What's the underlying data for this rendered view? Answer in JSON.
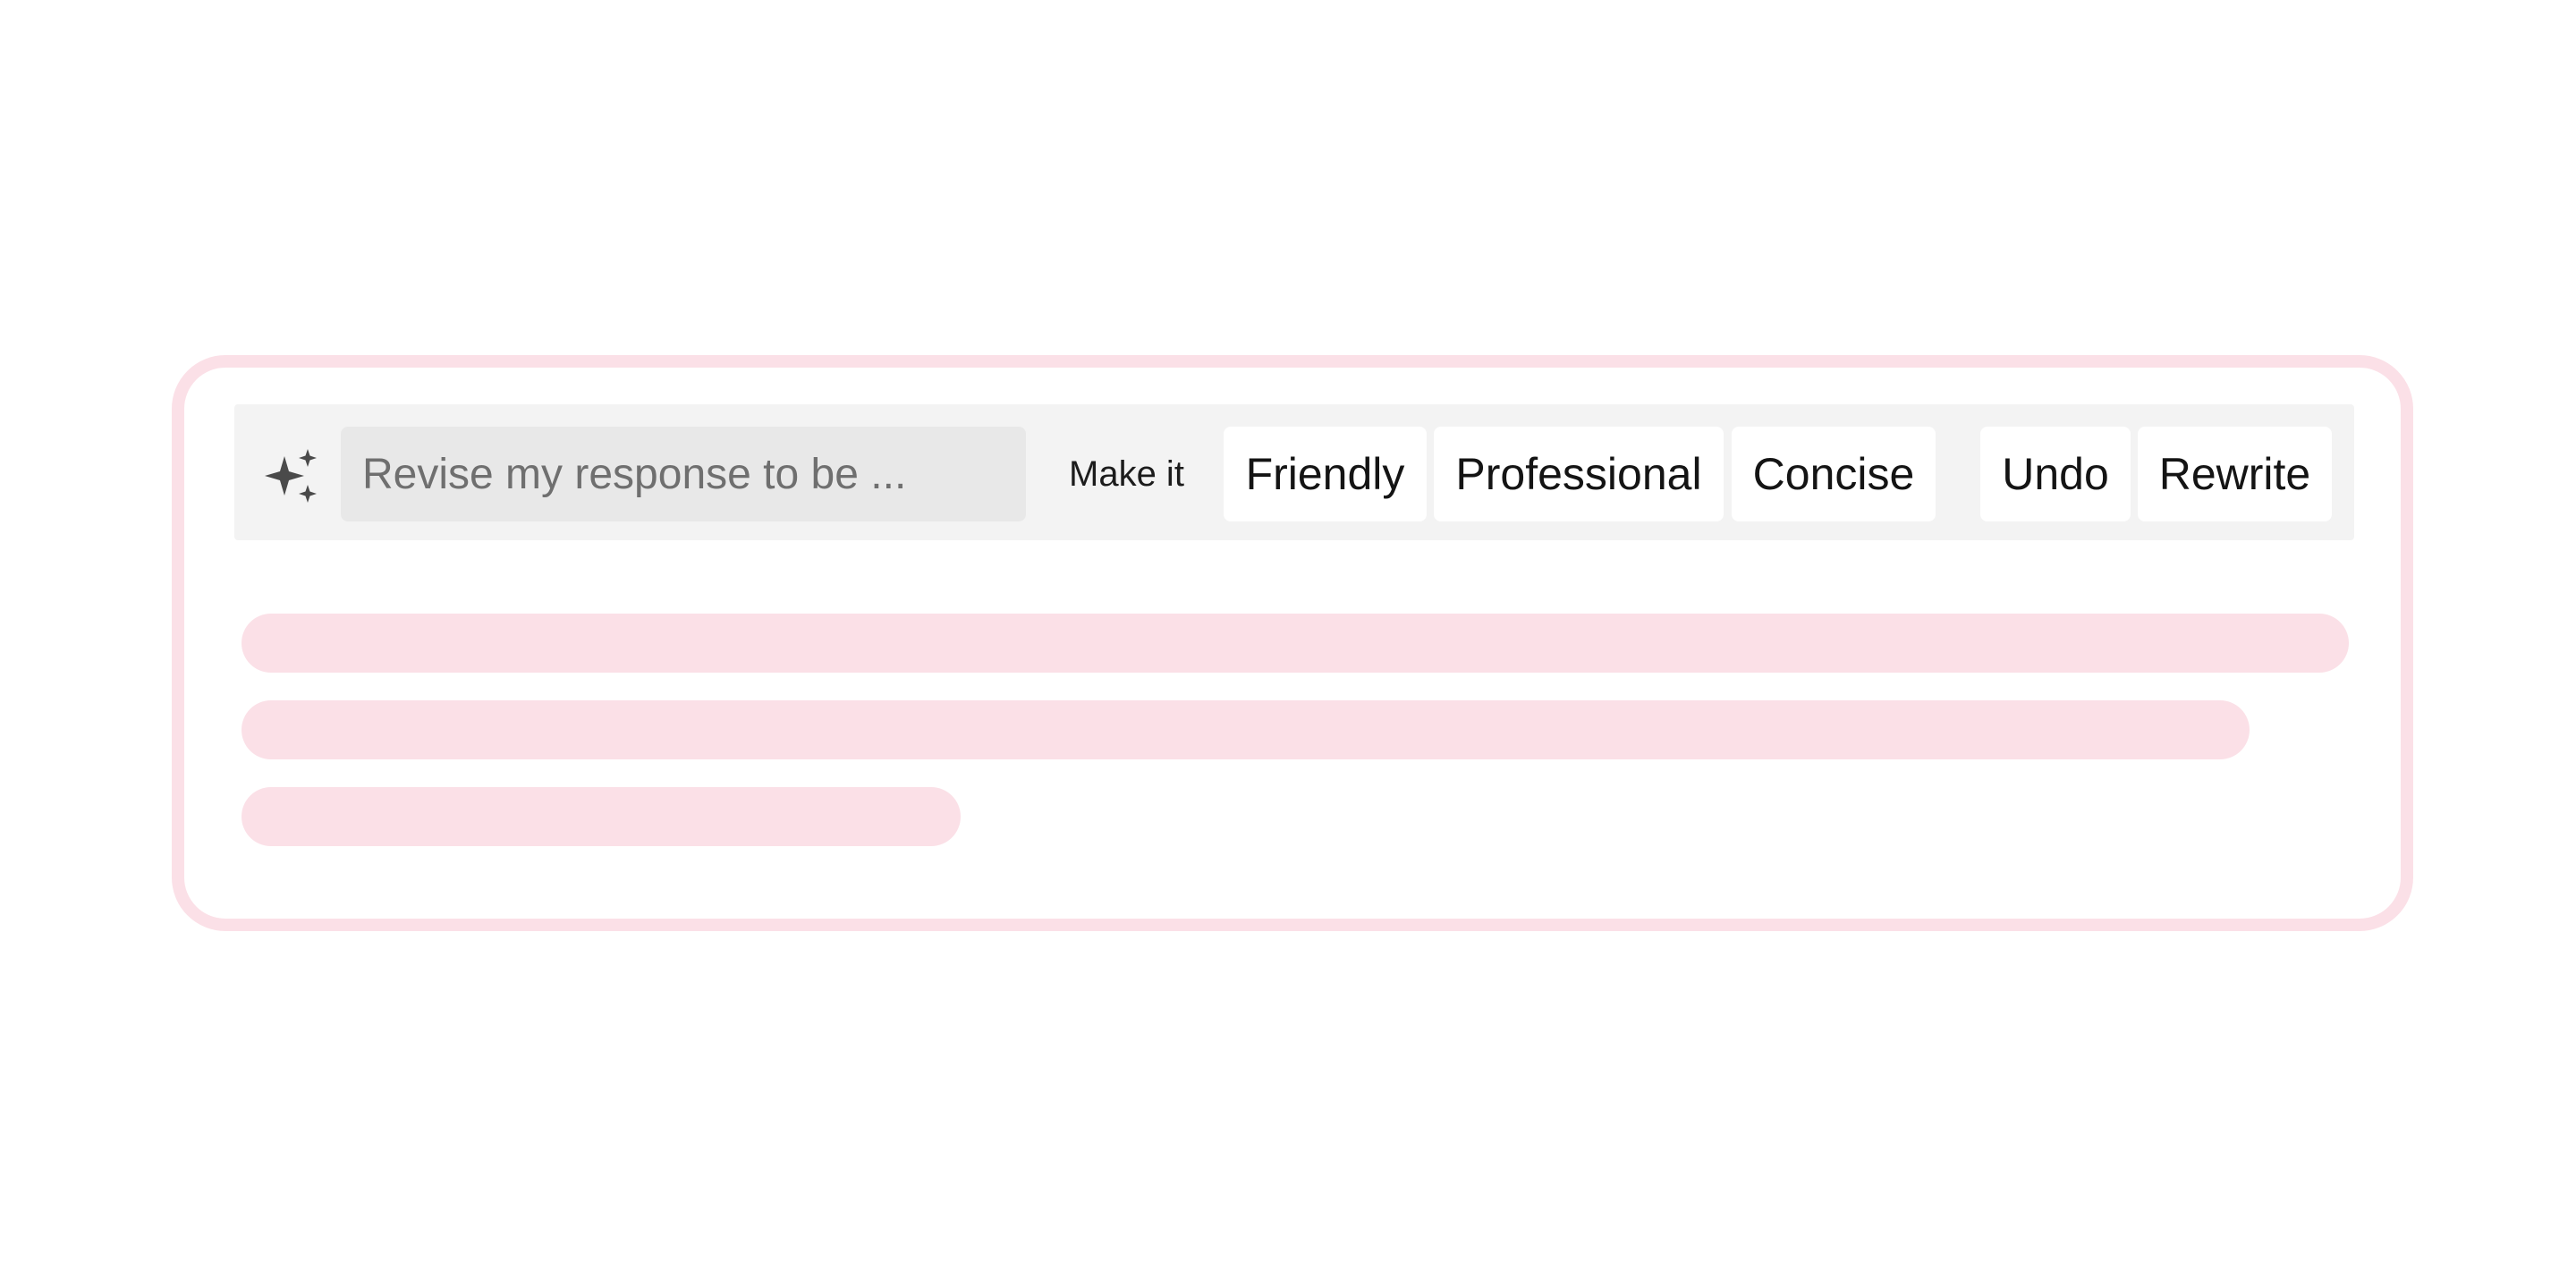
{
  "prompt": {
    "placeholder": "Revise my response to be ..."
  },
  "tone": {
    "label": "Make it",
    "options": [
      "Friendly",
      "Professional",
      "Concise"
    ]
  },
  "actions": {
    "undo_label": "Undo",
    "rewrite_label": "Rewrite"
  },
  "icons": {
    "sparkle": "sparkle-icon"
  },
  "colors": {
    "accent": "#fbe0e7",
    "toolbar_bg": "#f3f3f3",
    "input_bg": "#e8e8e8",
    "icon": "#4a4a4a"
  }
}
